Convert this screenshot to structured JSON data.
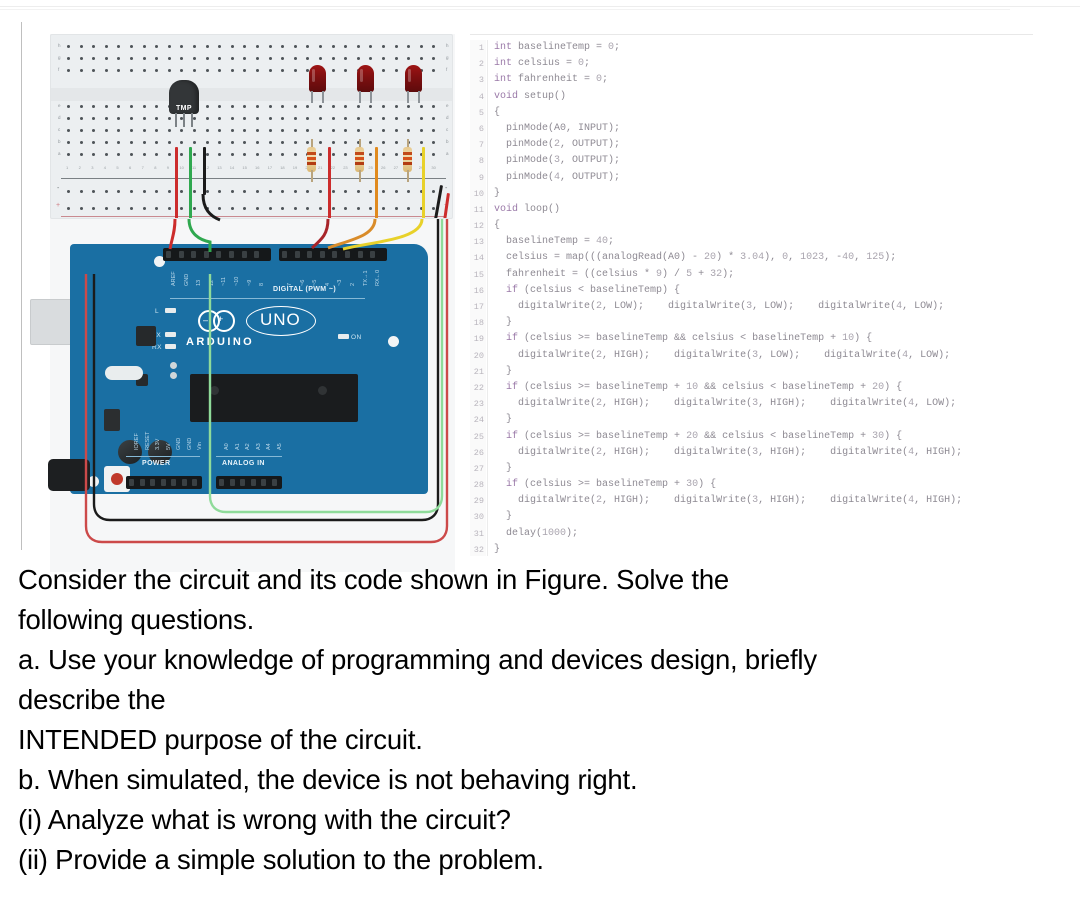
{
  "figure": {
    "name": "arduino-thermometer-circuit-and-code",
    "circuit": {
      "breadboard": {
        "component_labels": [
          "TMP"
        ],
        "row_letters_top": [
          "h",
          "g",
          "f"
        ],
        "row_letters_bottom": [
          "e",
          "d",
          "c",
          "b",
          "a"
        ],
        "rail_signs": [
          "-",
          "+"
        ],
        "leds": 3,
        "resistors": 3
      },
      "board": {
        "brand": "ARDUINO",
        "model": "UNO",
        "digital_header_label": "DIGITAL (PWM ~)",
        "power_header_label": "POWER",
        "analog_header_label": "ANALOG IN",
        "digital_pins": [
          "AREF",
          "GND",
          "13",
          "12",
          "~11",
          "~10",
          "~9",
          "8",
          "7",
          "~6",
          "~5",
          "4",
          "~3",
          "2",
          "TX→1",
          "RX←0"
        ],
        "power_pins": [
          "IOREF",
          "RESET",
          "3.3V",
          "5V",
          "GND",
          "GND",
          "Vin"
        ],
        "analog_pins": [
          "A0",
          "A1",
          "A2",
          "A3",
          "A4",
          "A5"
        ],
        "indicators": [
          "L",
          "TX",
          "RX",
          "ON"
        ]
      }
    },
    "code": {
      "language": "arduino",
      "lines": [
        {
          "n": "1",
          "text": "int baselineTemp = 0;"
        },
        {
          "n": "2",
          "text": "int celsius = 0;"
        },
        {
          "n": "3",
          "text": "int fahrenheit = 0;"
        },
        {
          "n": "4",
          "text": "void setup()"
        },
        {
          "n": "5",
          "text": "{"
        },
        {
          "n": "6",
          "text": "  pinMode(A0, INPUT);"
        },
        {
          "n": "7",
          "text": "  pinMode(2, OUTPUT);"
        },
        {
          "n": "8",
          "text": "  pinMode(3, OUTPUT);"
        },
        {
          "n": "9",
          "text": "  pinMode(4, OUTPUT);"
        },
        {
          "n": "10",
          "text": "}"
        },
        {
          "n": "11",
          "text": "void loop()"
        },
        {
          "n": "12",
          "text": "{"
        },
        {
          "n": "13",
          "text": "  baselineTemp = 40;"
        },
        {
          "n": "14",
          "text": "  celsius = map(((analogRead(A0) - 20) * 3.04), 0, 1023, -40, 125);"
        },
        {
          "n": "15",
          "text": "  fahrenheit = ((celsius * 9) / 5 + 32);"
        },
        {
          "n": "16",
          "text": "  if (celsius < baselineTemp) {"
        },
        {
          "n": "17",
          "text": "    digitalWrite(2, LOW);    digitalWrite(3, LOW);    digitalWrite(4, LOW);"
        },
        {
          "n": "18",
          "text": "  }"
        },
        {
          "n": "19",
          "text": "  if (celsius >= baselineTemp && celsius < baselineTemp + 10) {"
        },
        {
          "n": "20",
          "text": "    digitalWrite(2, HIGH);    digitalWrite(3, LOW);    digitalWrite(4, LOW);"
        },
        {
          "n": "21",
          "text": "  }"
        },
        {
          "n": "22",
          "text": "  if (celsius >= baselineTemp + 10 && celsius < baselineTemp + 20) {"
        },
        {
          "n": "23",
          "text": "    digitalWrite(2, HIGH);    digitalWrite(3, HIGH);    digitalWrite(4, LOW);"
        },
        {
          "n": "24",
          "text": "  }"
        },
        {
          "n": "25",
          "text": "  if (celsius >= baselineTemp + 20 && celsius < baselineTemp + 30) {"
        },
        {
          "n": "26",
          "text": "    digitalWrite(2, HIGH);    digitalWrite(3, HIGH);    digitalWrite(4, HIGH);"
        },
        {
          "n": "27",
          "text": "  }"
        },
        {
          "n": "28",
          "text": "  if (celsius >= baselineTemp + 30) {"
        },
        {
          "n": "29",
          "text": "    digitalWrite(2, HIGH);    digitalWrite(3, HIGH);    digitalWrite(4, HIGH);"
        },
        {
          "n": "30",
          "text": "  }"
        },
        {
          "n": "31",
          "text": "  delay(1000);"
        },
        {
          "n": "32",
          "text": "}"
        }
      ]
    }
  },
  "question": {
    "lines": [
      "Consider the circuit and its code shown in Figure. Solve the",
      "following questions.",
      "a. Use your knowledge of programming and devices design, briefly",
      "describe the",
      "INTENDED purpose of the circuit.",
      "b. When simulated, the device is not behaving right.",
      "(i) Analyze what is wrong with the circuit?",
      "(ii) Provide a simple solution to the problem."
    ]
  },
  "colors": {
    "board_blue": "#1a6fa3",
    "led_red": "#8e1113",
    "wire_red": "#cc2c2c",
    "wire_green": "#2fa84f",
    "wire_black": "#1b1b1b",
    "wire_orange": "#e08a1e",
    "wire_yellow": "#e8d12a",
    "code_keyword": "#9a79a8",
    "code_text": "#8e8a93",
    "page_background": "#ffffff"
  }
}
